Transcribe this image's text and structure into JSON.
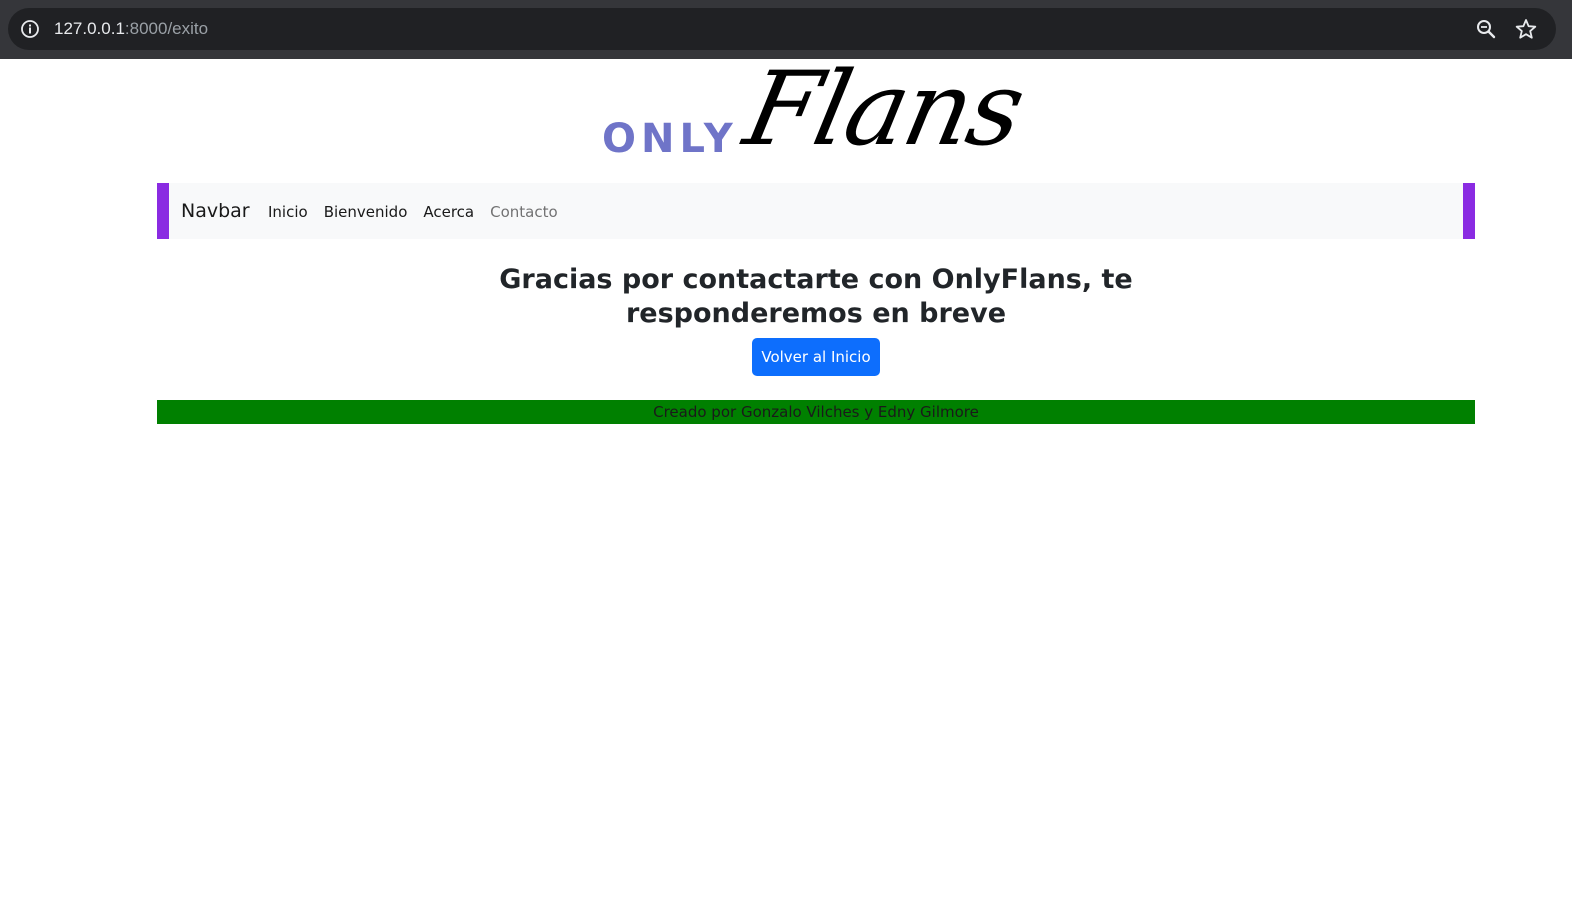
{
  "browser": {
    "url_host": "127.0.0.1",
    "url_rest": ":8000/exito"
  },
  "logo": {
    "only": "ONLY",
    "flans": "Flans"
  },
  "navbar": {
    "brand": "Navbar",
    "links": [
      {
        "label": "Inicio"
      },
      {
        "label": "Bienvenido"
      },
      {
        "label": "Acerca"
      },
      {
        "label": "Contacto"
      }
    ],
    "accent_color": "#8a2be2"
  },
  "main": {
    "heading": "Gracias por contactarte con OnlyFlans, te responderemos en breve",
    "button_label": "Volver al Inicio"
  },
  "footer": {
    "text": "Creado por Gonzalo Vilches y Edny Gilmore",
    "background": "#008000"
  }
}
